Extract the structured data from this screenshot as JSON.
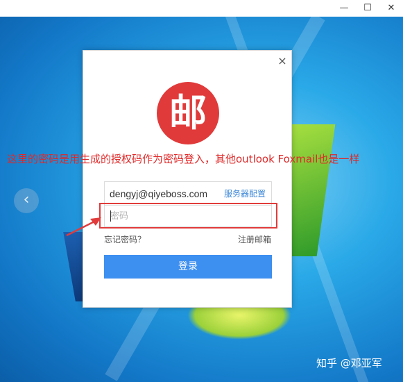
{
  "window": {
    "minimize_glyph": "—",
    "maximize_glyph": "☐",
    "close_glyph": "✕"
  },
  "desktop": {
    "nav_arrow_glyph": "‹"
  },
  "login": {
    "close_glyph": "×",
    "logo_char": "邮",
    "email_value": "dengyj@qiyeboss.com",
    "server_config_label": "服务器配置",
    "password_placeholder": "密码",
    "forgot_password_label": "忘记密码？",
    "register_label": "注册邮箱",
    "login_button_label": "登录"
  },
  "annotation": {
    "text": "这里的密码是用生成的授权码作为密码登入，其他outlook  Foxmail也是一样",
    "color": "#e02828"
  },
  "watermark": {
    "text": "知乎 @邓亚军"
  },
  "colors": {
    "logo_red": "#e13a3a",
    "button_blue": "#3d8ff0",
    "link_blue": "#3b86d6"
  }
}
